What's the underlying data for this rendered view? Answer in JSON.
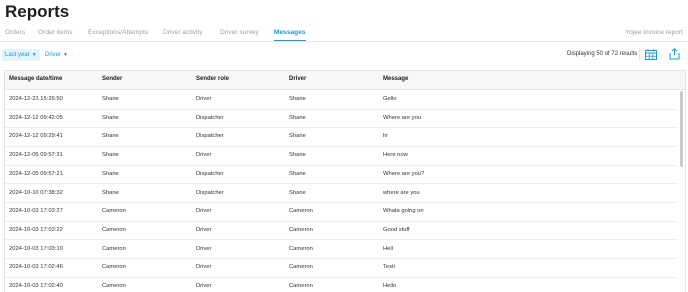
{
  "page": {
    "title": "Reports"
  },
  "tabs": [
    {
      "label": "Orders"
    },
    {
      "label": "Order items"
    },
    {
      "label": "Exceptions/Attempts"
    },
    {
      "label": "Driver activity"
    },
    {
      "label": "Driver survey"
    },
    {
      "label": "Messages",
      "active": true
    }
  ],
  "right_tab": {
    "label": "Yojee invoice report"
  },
  "filters": {
    "period": "Last year",
    "driver": "Driver"
  },
  "status": {
    "display_count": "Displaying 50 of 72 results"
  },
  "icons": {
    "calendar": "calendar-grid-icon",
    "export": "share-export-icon"
  },
  "colors": {
    "accent": "#1a9bd7",
    "tab_inactive": "#9aa2ab",
    "header_bg": "#f6f7f8"
  },
  "table": {
    "columns": [
      "Message date/time",
      "Sender",
      "Sender role",
      "Driver",
      "Message"
    ],
    "rows": [
      [
        "2024-12-23 15:26:50",
        "Shane",
        "Driver",
        "Shane",
        "Gello"
      ],
      [
        "2024-12-12 09:42:05",
        "Shane",
        "Dispatcher",
        "Shane",
        "Where are you"
      ],
      [
        "2024-12-12 09:29:41",
        "Shane",
        "Dispatcher",
        "Shane",
        "hi"
      ],
      [
        "2024-12-05 09:57:31",
        "Shane",
        "Driver",
        "Shane",
        "Here now"
      ],
      [
        "2024-12-05 09:57:21",
        "Shane",
        "Dispatcher",
        "Shane",
        "Where are you?"
      ],
      [
        "2024-10-10 07:38:32",
        "Shane",
        "Dispatcher",
        "Shane",
        "where are you"
      ],
      [
        "2024-10-03 17:03:27",
        "Cameron",
        "Driver",
        "Cameron",
        "Whata going on"
      ],
      [
        "2024-10-03 17:03:22",
        "Cameron",
        "Driver",
        "Cameron",
        "Good stuff"
      ],
      [
        "2024-10-03 17:03:10",
        "Cameron",
        "Driver",
        "Cameron",
        "Hell"
      ],
      [
        "2024-10-03 17:02:46",
        "Cameron",
        "Driver",
        "Cameron",
        "Testi"
      ],
      [
        "2024-10-03 17:02:40",
        "Cameron",
        "Driver",
        "Cameron",
        "Hello"
      ]
    ]
  }
}
